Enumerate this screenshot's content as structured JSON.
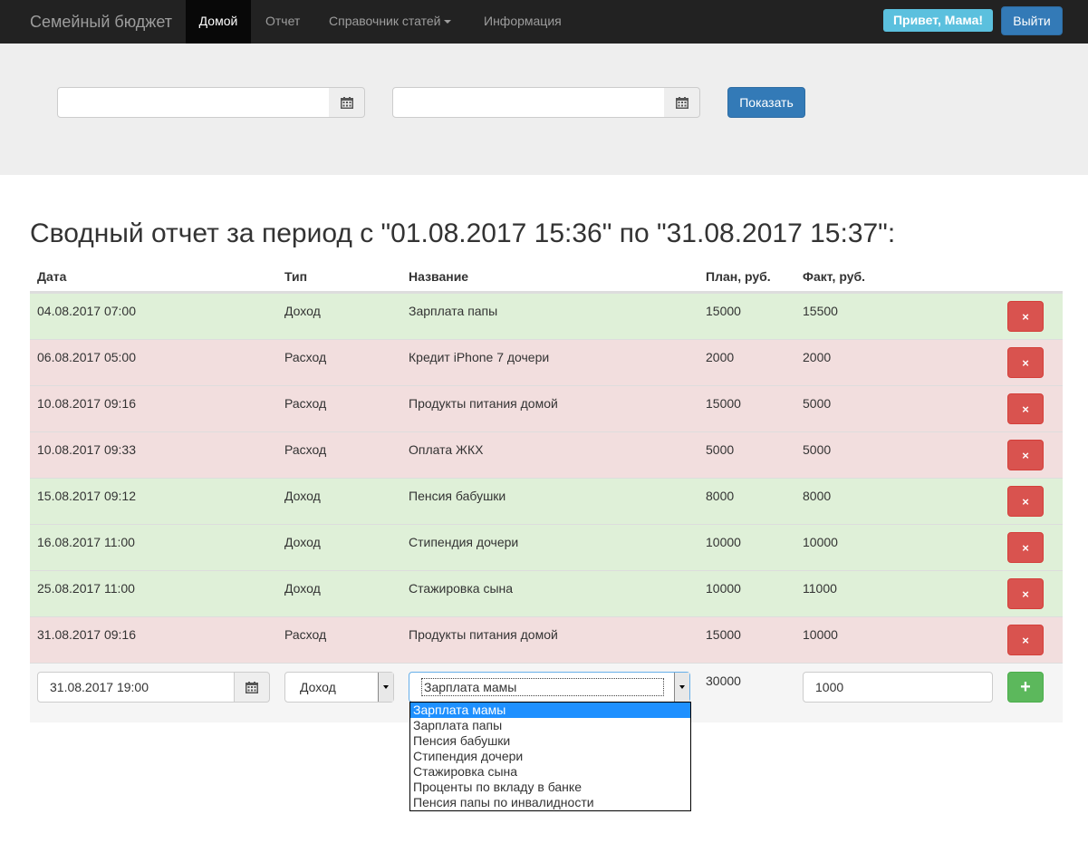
{
  "navbar": {
    "brand": "Семейный бюджет",
    "items": [
      {
        "label": "Домой",
        "active": true
      },
      {
        "label": "Отчет"
      },
      {
        "label": "Справочник статей"
      },
      {
        "label": "Информация"
      }
    ],
    "greeting": "Привет, Мама!",
    "logout": "Выйти"
  },
  "filter": {
    "date_from": "",
    "date_to": "",
    "show_button": "Показать"
  },
  "report": {
    "heading": "Сводный отчет за период с \"01.08.2017 15:36\" по \"31.08.2017 15:37\":",
    "columns": [
      "Дата",
      "Тип",
      "Название",
      "План, руб.",
      "Факт, руб."
    ],
    "rows": [
      {
        "date": "04.08.2017 07:00",
        "type": "Доход",
        "name": "Зарплата папы",
        "plan": "15000",
        "fact": "15500",
        "kind": "income"
      },
      {
        "date": "06.08.2017 05:00",
        "type": "Расход",
        "name": "Кредит iPhone 7 дочери",
        "plan": "2000",
        "fact": "2000",
        "kind": "expense"
      },
      {
        "date": "10.08.2017 09:16",
        "type": "Расход",
        "name": "Продукты питания домой",
        "plan": "15000",
        "fact": "5000",
        "kind": "expense"
      },
      {
        "date": "10.08.2017 09:33",
        "type": "Расход",
        "name": "Оплата ЖКХ",
        "plan": "5000",
        "fact": "5000",
        "kind": "expense"
      },
      {
        "date": "15.08.2017 09:12",
        "type": "Доход",
        "name": "Пенсия бабушки",
        "plan": "8000",
        "fact": "8000",
        "kind": "income"
      },
      {
        "date": "16.08.2017 11:00",
        "type": "Доход",
        "name": "Стипендия дочери",
        "plan": "10000",
        "fact": "10000",
        "kind": "income"
      },
      {
        "date": "25.08.2017 11:00",
        "type": "Доход",
        "name": "Стажировка сына",
        "plan": "10000",
        "fact": "11000",
        "kind": "income"
      },
      {
        "date": "31.08.2017 09:16",
        "type": "Расход",
        "name": "Продукты питания домой",
        "plan": "15000",
        "fact": "10000",
        "kind": "expense"
      }
    ],
    "delete_icon": "×",
    "colors": {
      "income": "#dff0d8",
      "expense": "#f2dede",
      "delete": "#d9534f",
      "add": "#5cb85c"
    }
  },
  "new_entry": {
    "date": "31.08.2017 19:00",
    "type": "Доход",
    "name": "Зарплата мамы",
    "plan": "30000",
    "fact": "1000",
    "add_icon": "+"
  },
  "name_dropdown": {
    "options": [
      "Зарплата мамы",
      "Зарплата папы",
      "Пенсия бабушки",
      "Стипендия дочери",
      "Стажировка сына",
      "Проценты по вкладу в банке",
      "Пенсия папы по инвалидности"
    ],
    "selected_index": 0
  }
}
